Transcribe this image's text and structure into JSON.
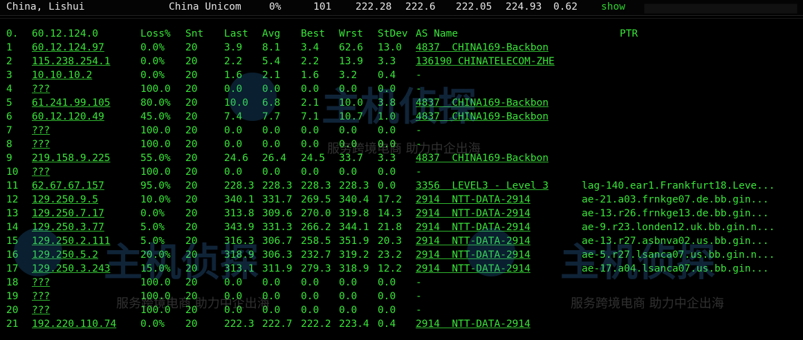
{
  "topbar": {
    "location": "China, Lishui",
    "isp": "China Unicom",
    "loss": "0%",
    "count": "101",
    "last": "222.28",
    "avg": "222.6",
    "best": "222.05",
    "worst": "224.93",
    "stdev": "0.62",
    "show_label": "show",
    "progress": 1.0
  },
  "header": {
    "hop": "0.",
    "host": "60.12.124.0",
    "loss": "Loss%",
    "snt": "Snt",
    "last": "Last",
    "avg": "Avg",
    "best": "Best",
    "wrst": "Wrst",
    "stdev": "StDev",
    "asname": "AS Name",
    "ptr": "PTR"
  },
  "hops": [
    {
      "n": "1",
      "host": "60.12.124.97",
      "loss": "0.0%",
      "snt": "20",
      "last": "3.9",
      "avg": "8.1",
      "best": "3.4",
      "wrst": "62.6",
      "stdev": "13.0",
      "as": "4837  CHINA169-Backbon",
      "ptr": ""
    },
    {
      "n": "2",
      "host": "115.238.254.1",
      "loss": "0.0%",
      "snt": "20",
      "last": "2.2",
      "avg": "5.4",
      "best": "2.2",
      "wrst": "13.9",
      "stdev": "3.3",
      "as": "136190 CHINATELECOM-ZHE",
      "ptr": ""
    },
    {
      "n": "3",
      "host": "10.10.10.2",
      "loss": "0.0%",
      "snt": "20",
      "last": "1.6",
      "avg": "2.1",
      "best": "1.6",
      "wrst": "3.2",
      "stdev": "0.4",
      "as": "-",
      "ptr": ""
    },
    {
      "n": "4",
      "host": "???",
      "loss": "100.0",
      "snt": "20",
      "last": "0.0",
      "avg": "0.0",
      "best": "0.0",
      "wrst": "0.0",
      "stdev": "0.0",
      "as": "-",
      "ptr": ""
    },
    {
      "n": "5",
      "host": "61.241.99.105",
      "loss": "80.0%",
      "snt": "20",
      "last": "10.0",
      "avg": "6.8",
      "best": "2.1",
      "wrst": "10.0",
      "stdev": "3.8",
      "as": "4837  CHINA169-Backbon",
      "ptr": ""
    },
    {
      "n": "6",
      "host": "60.12.120.49",
      "loss": "45.0%",
      "snt": "20",
      "last": "7.4",
      "avg": "7.7",
      "best": "7.1",
      "wrst": "10.7",
      "stdev": "1.0",
      "as": "4837  CHINA169-Backbon",
      "ptr": ""
    },
    {
      "n": "7",
      "host": "???",
      "loss": "100.0",
      "snt": "20",
      "last": "0.0",
      "avg": "0.0",
      "best": "0.0",
      "wrst": "0.0",
      "stdev": "0.0",
      "as": "-",
      "ptr": ""
    },
    {
      "n": "8",
      "host": "???",
      "loss": "100.0",
      "snt": "20",
      "last": "0.0",
      "avg": "0.0",
      "best": "0.0",
      "wrst": "0.0",
      "stdev": "0.0",
      "as": "-",
      "ptr": ""
    },
    {
      "n": "9",
      "host": "219.158.9.225",
      "loss": "55.0%",
      "snt": "20",
      "last": "24.6",
      "avg": "26.4",
      "best": "24.5",
      "wrst": "33.7",
      "stdev": "3.3",
      "as": "4837  CHINA169-Backbon",
      "ptr": ""
    },
    {
      "n": "10",
      "host": "???",
      "loss": "100.0",
      "snt": "20",
      "last": "0.0",
      "avg": "0.0",
      "best": "0.0",
      "wrst": "0.0",
      "stdev": "0.0",
      "as": "-",
      "ptr": ""
    },
    {
      "n": "11",
      "host": "62.67.67.157",
      "loss": "95.0%",
      "snt": "20",
      "last": "228.3",
      "avg": "228.3",
      "best": "228.3",
      "wrst": "228.3",
      "stdev": "0.0",
      "as": "3356  LEVEL3 - Level 3",
      "ptr": "lag-140.ear1.Frankfurt18.Leve..."
    },
    {
      "n": "12",
      "host": "129.250.9.5",
      "loss": "10.0%",
      "snt": "20",
      "last": "340.1",
      "avg": "331.7",
      "best": "269.5",
      "wrst": "340.4",
      "stdev": "17.2",
      "as": "2914  NTT-DATA-2914",
      "ptr": "ae-21.a03.frnkge07.de.bb.gin..."
    },
    {
      "n": "13",
      "host": "129.250.7.17",
      "loss": "0.0%",
      "snt": "20",
      "last": "313.8",
      "avg": "309.6",
      "best": "270.0",
      "wrst": "319.8",
      "stdev": "14.3",
      "as": "2914  NTT-DATA-2914",
      "ptr": "ae-13.r26.frnkge13.de.bb.gin..."
    },
    {
      "n": "14",
      "host": "129.250.3.77",
      "loss": "5.0%",
      "snt": "20",
      "last": "343.9",
      "avg": "331.3",
      "best": "266.2",
      "wrst": "344.1",
      "stdev": "21.8",
      "as": "2914  NTT-DATA-2914",
      "ptr": "ae-9.r23.londen12.uk.bb.gin.n..."
    },
    {
      "n": "15",
      "host": "129.250.2.111",
      "loss": "5.0%",
      "snt": "20",
      "last": "316.3",
      "avg": "306.7",
      "best": "258.5",
      "wrst": "351.9",
      "stdev": "20.3",
      "as": "2914  NTT-DATA-2914",
      "ptr": "ae-13.r27.asbnva02.us.bb.gin..."
    },
    {
      "n": "16",
      "host": "129.250.5.2",
      "loss": "20.0%",
      "snt": "20",
      "last": "318.9",
      "avg": "306.3",
      "best": "232.7",
      "wrst": "319.2",
      "stdev": "23.2",
      "as": "2914  NTT-DATA-2914",
      "ptr": "ae-5.r27.lsanca07.us.bb.gin.n..."
    },
    {
      "n": "17",
      "host": "129.250.3.243",
      "loss": "15.0%",
      "snt": "20",
      "last": "313.1",
      "avg": "311.9",
      "best": "279.3",
      "wrst": "318.9",
      "stdev": "12.2",
      "as": "2914  NTT-DATA-2914",
      "ptr": "ae-17.a04.lsanca07.us.bb.gin..."
    },
    {
      "n": "18",
      "host": "???",
      "loss": "100.0",
      "snt": "20",
      "last": "0.0",
      "avg": "0.0",
      "best": "0.0",
      "wrst": "0.0",
      "stdev": "0.0",
      "as": "-",
      "ptr": ""
    },
    {
      "n": "19",
      "host": "???",
      "loss": "100.0",
      "snt": "20",
      "last": "0.0",
      "avg": "0.0",
      "best": "0.0",
      "wrst": "0.0",
      "stdev": "0.0",
      "as": "-",
      "ptr": ""
    },
    {
      "n": "20",
      "host": "???",
      "loss": "100.0",
      "snt": "20",
      "last": "0.0",
      "avg": "0.0",
      "best": "0.0",
      "wrst": "0.0",
      "stdev": "0.0",
      "as": "-",
      "ptr": ""
    },
    {
      "n": "21",
      "host": "192.220.110.74",
      "loss": "0.0%",
      "snt": "20",
      "last": "222.3",
      "avg": "222.7",
      "best": "222.2",
      "wrst": "223.4",
      "stdev": "0.4",
      "as": "2914  NTT-DATA-2914",
      "ptr": ""
    }
  ],
  "watermark": {
    "brand": "主机侦探",
    "slogan": "服务跨境电商 助力中企出海"
  },
  "colors": {
    "text_green": "#38e638",
    "background": "#000000",
    "progress_fill": "#1fc81f"
  }
}
